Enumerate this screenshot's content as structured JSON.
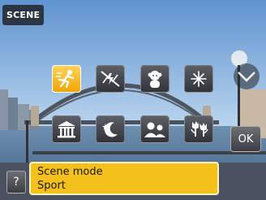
{
  "header": {
    "tag": "SCENE"
  },
  "scenes": [
    {
      "label": "Sport",
      "icon": "sport-runner-icon",
      "selected": true
    },
    {
      "label": "",
      "icon": "no-flash-icon",
      "selected": false
    },
    {
      "label": "",
      "icon": "child-icon",
      "selected": false
    },
    {
      "label": "",
      "icon": "fireworks-icon",
      "selected": false
    },
    {
      "label": "",
      "icon": "museum-icon",
      "selected": false
    },
    {
      "label": "",
      "icon": "night-moon-icon",
      "selected": false
    },
    {
      "label": "",
      "icon": "portrait-pair-icon",
      "selected": false
    },
    {
      "label": "",
      "icon": "tulip-icon",
      "selected": false
    }
  ],
  "description": {
    "title": "Scene mode",
    "value": "Sport"
  },
  "buttons": {
    "ok": "OK",
    "help": "?"
  },
  "colors": {
    "accent": "#f3c01c",
    "tile": "#44474d"
  }
}
